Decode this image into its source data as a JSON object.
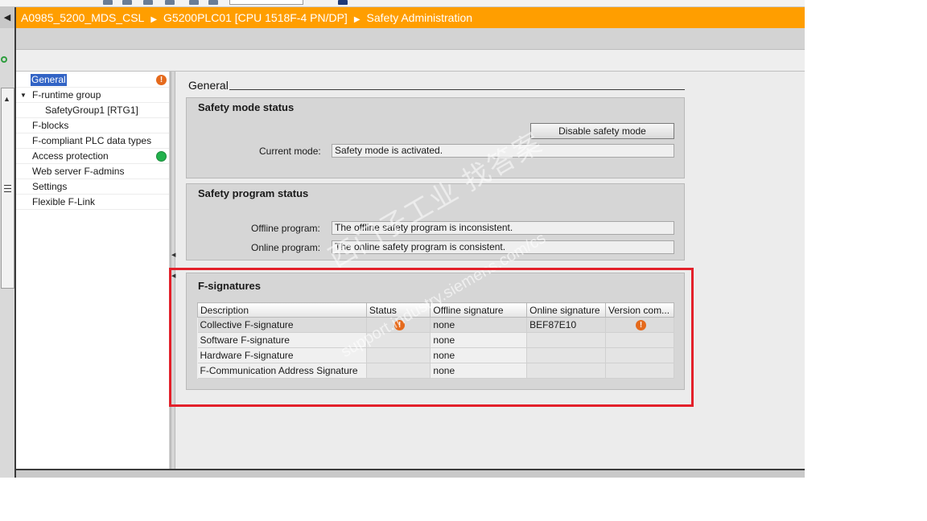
{
  "breadcrumb": {
    "items": [
      "A0985_5200_MDS_CSL",
      "G5200PLC01 [CPU 1518F-4 PN/DP]",
      "Safety Administration"
    ]
  },
  "navigation": {
    "items": [
      {
        "label": "General",
        "status": "warning",
        "selected": true
      },
      {
        "label": "F-runtime group",
        "expandable": true
      },
      {
        "label": "SafetyGroup1 [RTG1]",
        "child": true
      },
      {
        "label": "F-blocks"
      },
      {
        "label": "F-compliant PLC data types"
      },
      {
        "label": "Access protection",
        "status": "ok"
      },
      {
        "label": "Web server F-admins"
      },
      {
        "label": "Settings"
      },
      {
        "label": "Flexible F-Link"
      }
    ]
  },
  "content": {
    "heading": "General",
    "safety_mode": {
      "title": "Safety mode status",
      "button": "Disable safety mode",
      "current_mode_label": "Current mode:",
      "current_mode_value": "Safety mode is activated."
    },
    "safety_program": {
      "title": "Safety program status",
      "offline_label": "Offline program:",
      "offline_value": "The offline safety program is inconsistent.",
      "online_label": "Online program:",
      "online_value": "The online safety program is consistent."
    },
    "f_signatures": {
      "title": "F-signatures",
      "columns": [
        "Description",
        "Status",
        "Offline signature",
        "Online signature",
        "Version com..."
      ],
      "rows": [
        {
          "description": "Collective F-signature",
          "status": "warning",
          "offline": "none",
          "online": "BEF87E10",
          "version": "warning"
        },
        {
          "description": "Software F-signature",
          "status": "",
          "offline": "none",
          "online": "",
          "version": ""
        },
        {
          "description": "Hardware F-signature",
          "status": "",
          "offline": "none",
          "online": "",
          "version": ""
        },
        {
          "description": "F-Communication Address Signature",
          "status": "",
          "offline": "none",
          "online": "",
          "version": ""
        }
      ]
    }
  },
  "watermark": {
    "line1": "西门子工业 找答案",
    "line2": "support.industry.siemens.com/cs"
  },
  "colors": {
    "breadcrumb_bg": "#ff9e00",
    "selection": "#3163c5",
    "warning": "#e56a1c",
    "ok": "#22b14c",
    "highlight": "#e3202a"
  },
  "icons": {
    "warning": "warning-icon",
    "ok": "status-ok-icon"
  }
}
